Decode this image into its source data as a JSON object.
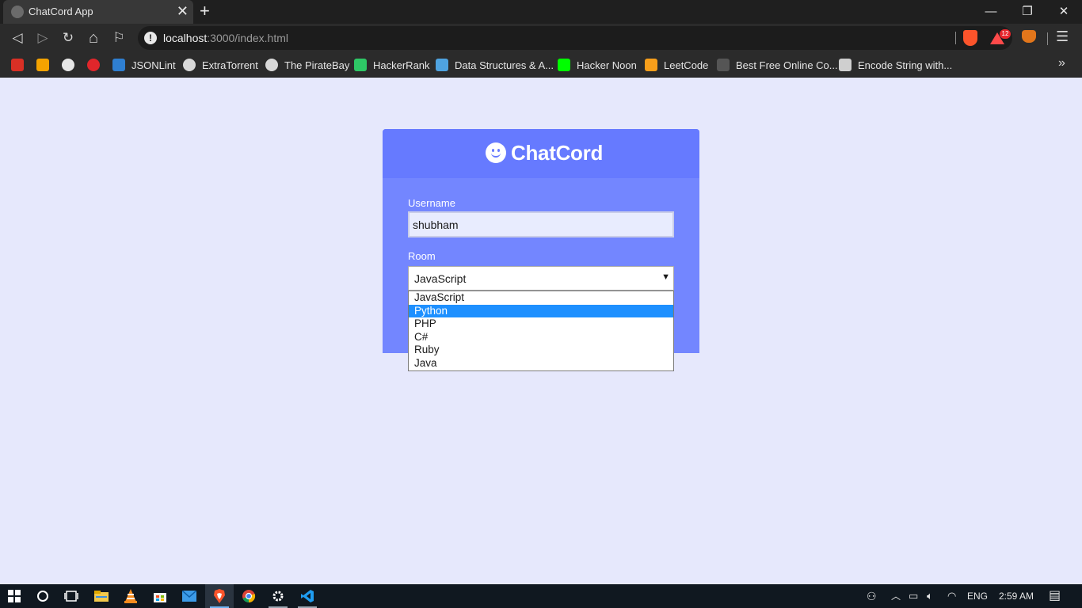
{
  "browser": {
    "tab_title": "ChatCord App",
    "tab_close": "✕",
    "new_tab": "+",
    "window_controls": {
      "minimize": "—",
      "restore": "❐",
      "close": "✕"
    },
    "nav": {
      "back": "◁",
      "forward": "▷",
      "reload": "↻",
      "home": "⌂",
      "bookmark": "⚐"
    },
    "url_host": "localhost",
    "url_path": ":3000/index.html",
    "shield_badge": "12",
    "menu": "☰",
    "bookmarks": [
      {
        "label": "",
        "icon": "gmail-icon",
        "color": "#d93025"
      },
      {
        "label": "",
        "icon": "hourglass-icon",
        "color": "#f4a300"
      },
      {
        "label": "",
        "icon": "github-icon",
        "color": "#e6e6e6"
      },
      {
        "label": "",
        "icon": "opera-icon",
        "color": "#e0262b"
      },
      {
        "label": "JSONLint",
        "icon": "json-icon",
        "color": "#2f7fd1"
      },
      {
        "label": "ExtraTorrent",
        "icon": "globe-icon",
        "color": "#d8d8d8"
      },
      {
        "label": "The PirateBay",
        "icon": "globe-icon",
        "color": "#d8d8d8"
      },
      {
        "label": "HackerRank",
        "icon": "hackerrank-icon",
        "color": "#2ec866"
      },
      {
        "label": "Data Structures & A...",
        "icon": "udemy-icon",
        "color": "#4fa3e0"
      },
      {
        "label": "Hacker Noon",
        "icon": "hackernoon-icon",
        "color": "#00ff00"
      },
      {
        "label": "LeetCode",
        "icon": "leetcode-icon",
        "color": "#f89f1b"
      },
      {
        "label": "Best Free Online Co...",
        "icon": "shield-page-icon",
        "color": "#555555"
      },
      {
        "label": "Encode String with...",
        "icon": "book-icon",
        "color": "#cfcfcf"
      }
    ],
    "bookmarks_more": "»"
  },
  "page": {
    "brand": "ChatCord",
    "username_label": "Username",
    "username_value": "shubham",
    "room_label": "Room",
    "room_selected": "JavaScript",
    "select_arrow": "▼",
    "room_options": [
      "JavaScript",
      "Python",
      "PHP",
      "C#",
      "Ruby",
      "Java"
    ],
    "highlighted_option": "Python"
  },
  "taskbar": {
    "language": "ENG",
    "time": "2:59 AM"
  },
  "colors": {
    "page_bg": "#e6e8fc",
    "header": "#667aff",
    "form_bg": "#7386ff",
    "option_highlight": "#1e90ff"
  }
}
